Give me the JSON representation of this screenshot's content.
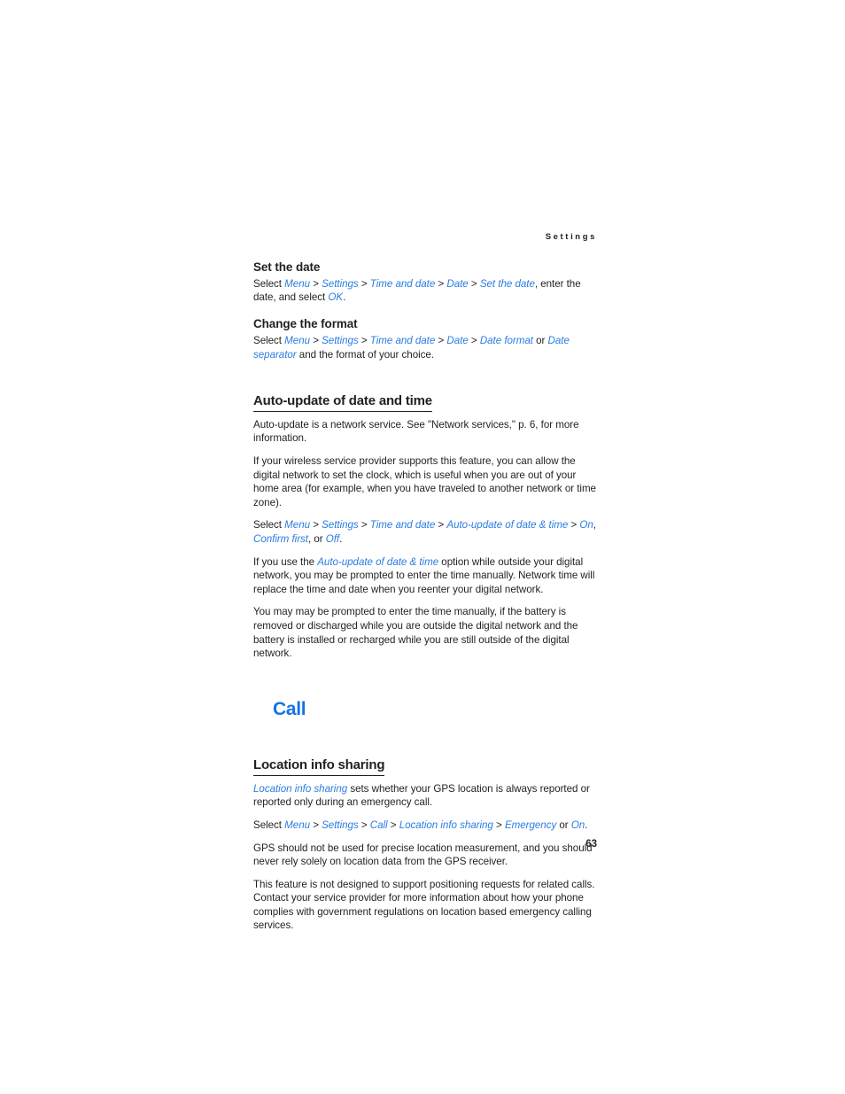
{
  "page": {
    "running_header": "Settings",
    "folio": "63",
    "accent_blue": "#2a7de1",
    "chapter_blue": "#1373e6",
    "text_color": "#231f20"
  },
  "sections": [
    {
      "id": "set-the-date",
      "heading": "Set the date",
      "heading_style": "sub",
      "paragraphs": [
        {
          "id": "set-the-date-path",
          "runs": [
            {
              "t": "Select ",
              "k": "plain"
            },
            {
              "t": "Menu",
              "k": "ui"
            },
            {
              "t": " > ",
              "k": "sep"
            },
            {
              "t": "Settings",
              "k": "ui"
            },
            {
              "t": " > ",
              "k": "sep"
            },
            {
              "t": "Time and date",
              "k": "ui"
            },
            {
              "t": " > ",
              "k": "sep"
            },
            {
              "t": "Date",
              "k": "ui"
            },
            {
              "t": " > ",
              "k": "sep"
            },
            {
              "t": "Set the date",
              "k": "ui"
            },
            {
              "t": ", enter the date, and select ",
              "k": "plain"
            },
            {
              "t": "OK",
              "k": "ui"
            },
            {
              "t": ".",
              "k": "plain"
            }
          ]
        }
      ]
    },
    {
      "id": "change-the-format",
      "heading": "Change the format",
      "heading_style": "sub",
      "paragraphs": [
        {
          "id": "change-the-format-path",
          "runs": [
            {
              "t": "Select ",
              "k": "plain"
            },
            {
              "t": "Menu",
              "k": "ui"
            },
            {
              "t": " > ",
              "k": "sep"
            },
            {
              "t": "Settings",
              "k": "ui"
            },
            {
              "t": " > ",
              "k": "sep"
            },
            {
              "t": "Time and date",
              "k": "ui"
            },
            {
              "t": " > ",
              "k": "sep"
            },
            {
              "t": "Date",
              "k": "ui"
            },
            {
              "t": " > ",
              "k": "sep"
            },
            {
              "t": "Date format",
              "k": "ui"
            },
            {
              "t": " or ",
              "k": "plain"
            },
            {
              "t": "Date separator",
              "k": "ui"
            },
            {
              "t": " and the format of your choice.",
              "k": "plain"
            }
          ]
        }
      ]
    },
    {
      "id": "auto-update-of-date-and-time",
      "heading": "Auto-update of date and time",
      "heading_style": "section",
      "paragraphs": [
        {
          "id": "auto-update-network-service",
          "runs": [
            {
              "t": "Auto-update is a network service. See \"Network services,\" p. 6, for more information.",
              "k": "plain"
            }
          ]
        },
        {
          "id": "auto-update-provider-support",
          "runs": [
            {
              "t": "If your wireless service provider supports this feature, you can allow the digital network to set the clock, which is useful when you are out of your home area (for example, when you have traveled to another network or time zone).",
              "k": "plain"
            }
          ]
        },
        {
          "id": "auto-update-path",
          "runs": [
            {
              "t": "Select ",
              "k": "plain"
            },
            {
              "t": "Menu",
              "k": "ui"
            },
            {
              "t": " > ",
              "k": "sep"
            },
            {
              "t": "Settings",
              "k": "ui"
            },
            {
              "t": " > ",
              "k": "sep"
            },
            {
              "t": "Time and date",
              "k": "ui"
            },
            {
              "t": " > ",
              "k": "sep"
            },
            {
              "t": "Auto-update of date & time",
              "k": "ui"
            },
            {
              "t": " > ",
              "k": "sep"
            },
            {
              "t": "On",
              "k": "ui"
            },
            {
              "t": ", ",
              "k": "plain"
            },
            {
              "t": "Confirm first",
              "k": "ui"
            },
            {
              "t": ", or ",
              "k": "plain"
            },
            {
              "t": "Off",
              "k": "ui"
            },
            {
              "t": ".",
              "k": "plain"
            }
          ]
        },
        {
          "id": "auto-update-outside-network",
          "runs": [
            {
              "t": "If you use the ",
              "k": "plain"
            },
            {
              "t": "Auto-update of date & time",
              "k": "ui"
            },
            {
              "t": " option while outside your digital network, you may be prompted to enter the time manually. Network time will replace the time and date when you reenter your digital network.",
              "k": "plain"
            }
          ]
        },
        {
          "id": "auto-update-battery-removed",
          "runs": [
            {
              "t": "You may may be prompted to enter the time manually, if the battery is removed or discharged while you are outside the digital network and the battery is installed or recharged while you are still outside of the digital network.",
              "k": "plain"
            }
          ]
        }
      ]
    },
    {
      "id": "call",
      "heading": "Call",
      "heading_style": "chapter",
      "paragraphs": []
    },
    {
      "id": "location-info-sharing",
      "heading": "Location info sharing",
      "heading_style": "section",
      "paragraphs": [
        {
          "id": "location-info-sharing-desc",
          "runs": [
            {
              "t": "Location info sharing",
              "k": "ui"
            },
            {
              "t": " sets whether your GPS location is always reported or reported only during an emergency call.",
              "k": "plain"
            }
          ]
        },
        {
          "id": "location-info-sharing-path",
          "runs": [
            {
              "t": "Select ",
              "k": "plain"
            },
            {
              "t": "Menu",
              "k": "ui"
            },
            {
              "t": " > ",
              "k": "sep"
            },
            {
              "t": "Settings",
              "k": "ui"
            },
            {
              "t": " > ",
              "k": "sep"
            },
            {
              "t": "Call",
              "k": "ui"
            },
            {
              "t": " > ",
              "k": "sep"
            },
            {
              "t": "Location info sharing",
              "k": "ui"
            },
            {
              "t": " > ",
              "k": "sep"
            },
            {
              "t": "Emergency",
              "k": "ui"
            },
            {
              "t": " or ",
              "k": "plain"
            },
            {
              "t": "On",
              "k": "ui"
            },
            {
              "t": ".",
              "k": "plain"
            }
          ]
        },
        {
          "id": "location-gps-precision",
          "runs": [
            {
              "t": "GPS should not be used for precise location measurement, and you should never rely solely on location data from the GPS receiver.",
              "k": "plain"
            }
          ]
        },
        {
          "id": "location-positioning-requests",
          "runs": [
            {
              "t": "This feature is not designed to support positioning requests for related calls. Contact your service provider for more information about how your phone complies with government regulations on location based emergency calling services.",
              "k": "plain"
            }
          ]
        }
      ]
    }
  ]
}
